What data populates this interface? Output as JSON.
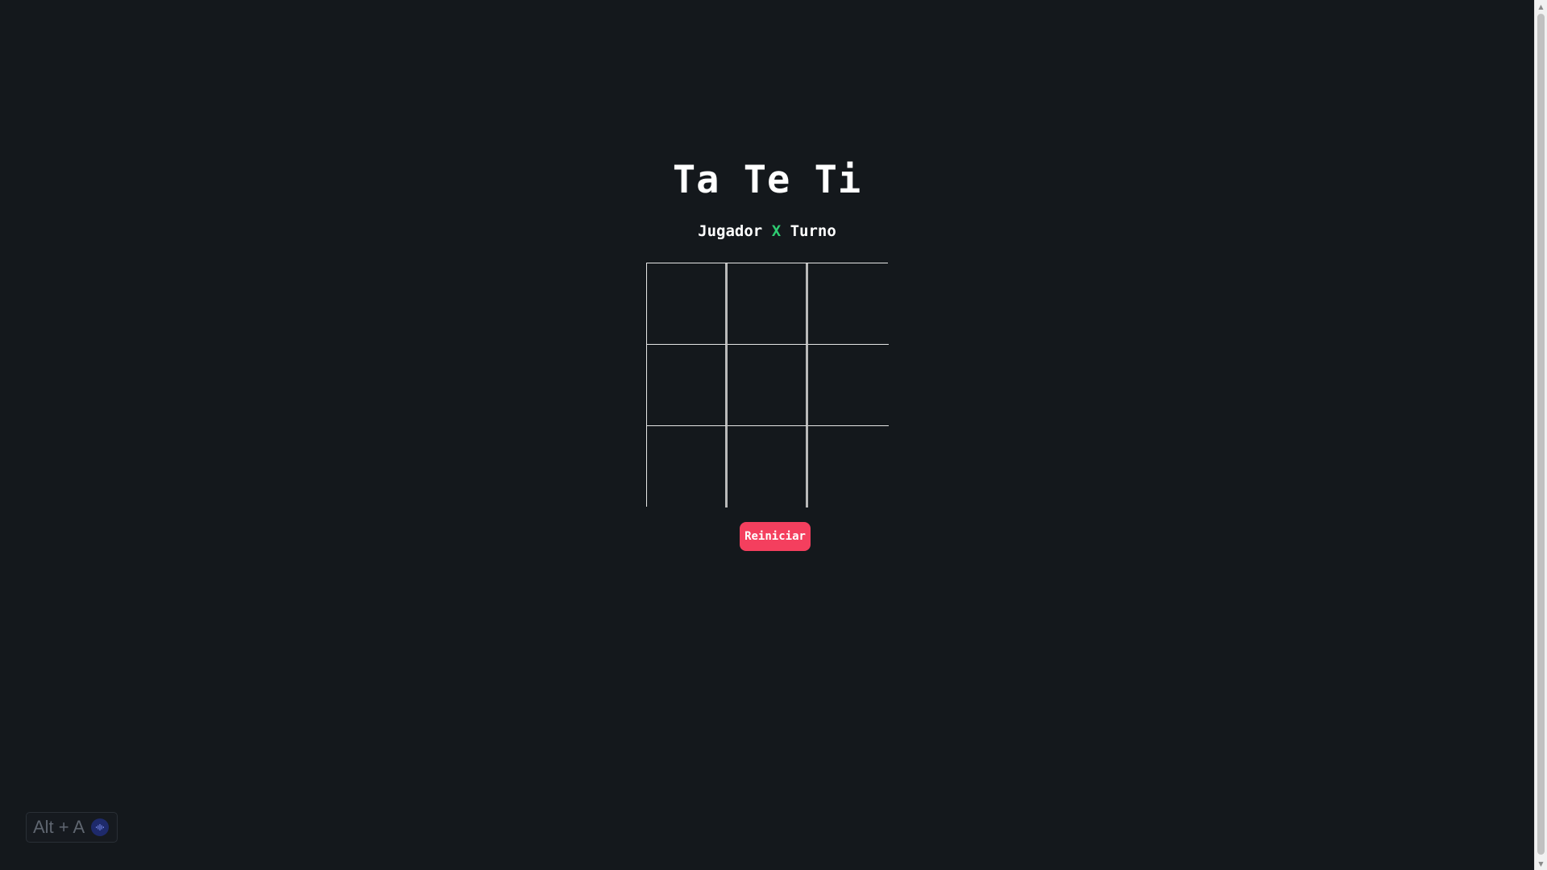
{
  "game": {
    "title": "Ta Te Ti",
    "turn": {
      "prefix": "Jugador",
      "player": "X",
      "suffix": "Turno",
      "player_color": "#2ecc71"
    },
    "board": [
      [
        "",
        "",
        ""
      ],
      [
        "",
        "",
        ""
      ],
      [
        "",
        "",
        ""
      ]
    ],
    "reset_label": "Reiniciar",
    "reset_color": "#f43f5e"
  },
  "shortcut": {
    "label": "Alt + A",
    "icon": "audio-wave-icon"
  },
  "colors": {
    "background": "#14181c",
    "text": "#ffffff"
  }
}
